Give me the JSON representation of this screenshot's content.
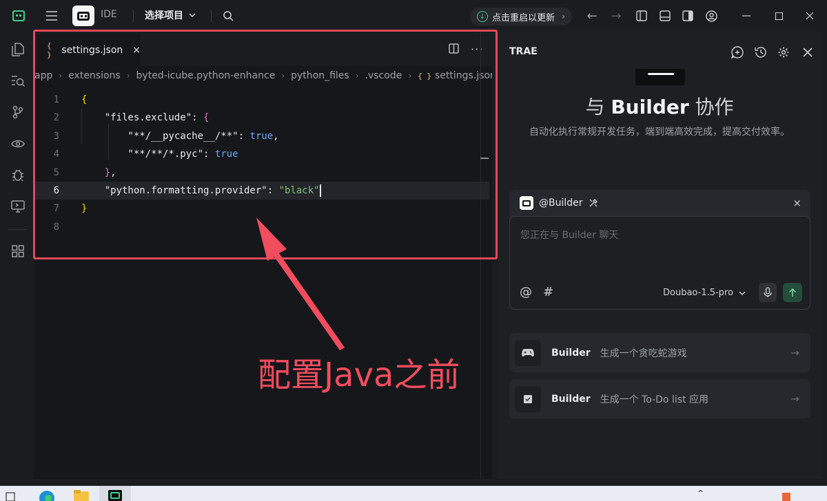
{
  "titlebar": {
    "mode_label": "IDE",
    "project_select": "选择项目",
    "update_label": "点击重启以更新"
  },
  "editor": {
    "tab": {
      "file_icon": "{ }",
      "name": "settings.json",
      "close": "×"
    },
    "breadcrumb": [
      "app",
      "extensions",
      "byted-icube.python-enhance",
      "python_files",
      ".vscode",
      "settings.json"
    ],
    "breadcrumb_file_icon": "{ }",
    "lines": [
      {
        "n": "1",
        "tokens": [
          {
            "t": "{",
            "c": "tok-brace"
          }
        ]
      },
      {
        "n": "2",
        "tokens": [
          {
            "t": "    \"files.exclude\"",
            "c": "tok-key"
          },
          {
            "t": ": ",
            "c": "tok-punct"
          },
          {
            "t": "{",
            "c": "tok-brace2"
          }
        ]
      },
      {
        "n": "3",
        "tokens": [
          {
            "t": "        \"**/__pycache__/**\"",
            "c": "tok-key"
          },
          {
            "t": ": ",
            "c": "tok-punct"
          },
          {
            "t": "true",
            "c": "tok-bool"
          },
          {
            "t": ",",
            "c": "tok-punct"
          }
        ]
      },
      {
        "n": "4",
        "tokens": [
          {
            "t": "        \"**/**/*.pyc\"",
            "c": "tok-key"
          },
          {
            "t": ": ",
            "c": "tok-punct"
          },
          {
            "t": "true",
            "c": "tok-bool"
          }
        ]
      },
      {
        "n": "5",
        "tokens": [
          {
            "t": "    }",
            "c": "tok-brace2"
          },
          {
            "t": ",",
            "c": "tok-punct"
          }
        ]
      },
      {
        "n": "6",
        "tokens": [
          {
            "t": "    \"python.formatting.provider\"",
            "c": "tok-key"
          },
          {
            "t": ": ",
            "c": "tok-punct"
          },
          {
            "t": "\"black\"",
            "c": "tok-str"
          }
        ],
        "active": true
      },
      {
        "n": "7",
        "tokens": [
          {
            "t": "}",
            "c": "tok-brace"
          }
        ]
      },
      {
        "n": "8",
        "tokens": []
      }
    ]
  },
  "annotation": "配置Java之前",
  "panel": {
    "title": "TRAE",
    "hero_prefix": "与 ",
    "hero_strong": "Builder",
    "hero_suffix": " 协作",
    "hero_sub": "自动化执行常规开发任务，端到端高效完成，提高交付效率。",
    "chat": {
      "agent": "@Builder",
      "close": "×",
      "placeholder": "您正在与 Builder 聊天",
      "at_tool": "@",
      "hash_tool": "#",
      "model": "Doubao-1.5-pro"
    },
    "suggestions": [
      {
        "name": "Builder",
        "text": "生成一个贪吃蛇游戏",
        "icon": "gamepad-icon"
      },
      {
        "name": "Builder",
        "text": "生成一个 To-Do list 应用",
        "icon": "checkbox-icon"
      }
    ]
  },
  "colors": {
    "accent_green": "#3ecf8e",
    "annotation_red": "#f14d5e",
    "highlight_box": "#e8485c"
  }
}
